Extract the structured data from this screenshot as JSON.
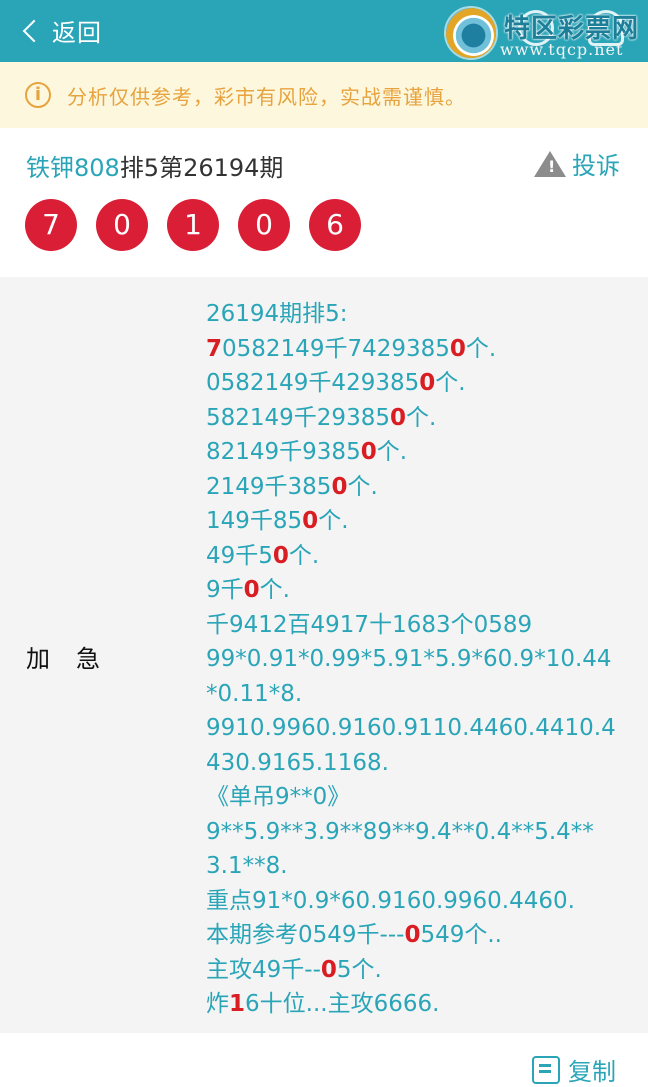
{
  "header": {
    "back_label": "返回",
    "watermark_title": "特区彩票网",
    "watermark_url": "www.tqcp.net"
  },
  "notice": {
    "text": "分析仅供参考，彩市有风险，实战需谨慎。"
  },
  "post": {
    "author": "铁钾808",
    "title_rest": "排5第26194期",
    "complain_label": "投诉",
    "balls": [
      "7",
      "0",
      "1",
      "0",
      "6"
    ]
  },
  "content": {
    "label": "加急",
    "lines": [
      [
        {
          "t": "26194期排5:"
        }
      ],
      [
        {
          "t": "7",
          "red": true
        },
        {
          "t": "0582149千742938 5"
        },
        {
          "t": "0",
          "red": true
        },
        {
          "t": "个."
        }
      ],
      [
        {
          "t": "0582149千429385"
        },
        {
          "t": "0",
          "red": true
        },
        {
          "t": "个."
        }
      ],
      [
        {
          "t": "582149千29385"
        },
        {
          "t": "0",
          "red": true
        },
        {
          "t": "个."
        }
      ],
      [
        {
          "t": "82149千9385"
        },
        {
          "t": "0",
          "red": true
        },
        {
          "t": "个."
        }
      ],
      [
        {
          "t": "2149千385"
        },
        {
          "t": "0",
          "red": true
        },
        {
          "t": "个."
        }
      ],
      [
        {
          "t": "149千85"
        },
        {
          "t": "0",
          "red": true
        },
        {
          "t": "个."
        }
      ],
      [
        {
          "t": "49千5"
        },
        {
          "t": "0",
          "red": true
        },
        {
          "t": "个."
        }
      ],
      [
        {
          "t": "9千"
        },
        {
          "t": "0",
          "red": true
        },
        {
          "t": "个."
        }
      ],
      [
        {
          "t": "千9412百4917十1683个0589"
        }
      ],
      [
        {
          "t": "99*0.91*0.99*5.91*5.9*60.9*10.44"
        }
      ],
      [
        {
          "t": "*0.11*8."
        }
      ],
      [
        {
          "t": "9910.9960.9160.9110.4460.4410.4"
        }
      ],
      [
        {
          "t": "430.9165.1168."
        }
      ],
      [
        {
          "t": "《单吊9**0》"
        }
      ],
      [
        {
          "t": "9**5.9**3.9**89**9.4**0.4**5.4**"
        }
      ],
      [
        {
          "t": "3.1**8."
        }
      ],
      [
        {
          "t": "重点91*0.9*60.9160.9960.4460."
        }
      ],
      [
        {
          "t": "本期参考0549千---"
        },
        {
          "t": "0",
          "red": true
        },
        {
          "t": "549个.."
        }
      ],
      [
        {
          "t": "主攻49千--"
        },
        {
          "t": "0",
          "red": true
        },
        {
          "t": "5个."
        }
      ],
      [
        {
          "t": "炸"
        },
        {
          "t": "1",
          "red": true
        },
        {
          "t": "6十位...主攻6666."
        }
      ]
    ]
  },
  "footer": {
    "copy_label": "复制"
  }
}
